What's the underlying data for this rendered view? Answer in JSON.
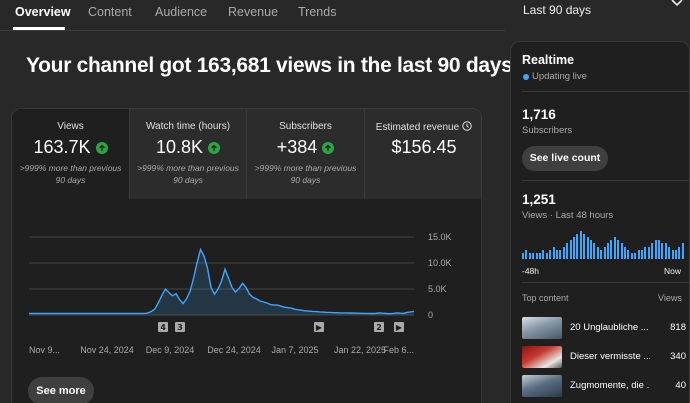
{
  "tabs": [
    {
      "label": "Overview",
      "active": true
    },
    {
      "label": "Content",
      "active": false
    },
    {
      "label": "Audience",
      "active": false
    },
    {
      "label": "Revenue",
      "active": false
    },
    {
      "label": "Trends",
      "active": false
    }
  ],
  "period_selector": {
    "label": "Last 90 days"
  },
  "headline": "Your channel got 163,681 views in the last 90 days",
  "metrics": [
    {
      "label": "Views",
      "value": "163.7K",
      "change": ">999% more than previous 90 days",
      "trend": "up"
    },
    {
      "label": "Watch time (hours)",
      "value": "10.8K",
      "change": ">999% more than previous 90 days",
      "trend": "up"
    },
    {
      "label": "Subscribers",
      "value": "+384",
      "change": ">999% more than previous 90 days",
      "trend": "up"
    },
    {
      "label": "Estimated revenue",
      "value": "$156.45",
      "icon": "info-icon"
    }
  ],
  "chart_data": {
    "type": "area",
    "series": [
      {
        "name": "",
        "color": "#3ea6ff",
        "values": [
          300,
          300,
          300,
          300,
          300,
          300,
          300,
          300,
          300,
          300,
          300,
          300,
          300,
          300,
          300,
          300,
          300,
          300,
          300,
          300,
          300,
          300,
          300,
          300,
          300,
          300,
          300,
          300,
          300,
          300,
          300,
          300,
          300,
          300,
          400,
          700,
          1200,
          2400,
          3800,
          5000,
          4300,
          3700,
          4100,
          3000,
          2200,
          3100,
          4500,
          7000,
          10000,
          12600,
          11300,
          9000,
          5300,
          4000,
          5000,
          6500,
          8800,
          7100,
          5300,
          4400,
          5100,
          6100,
          5300,
          4000,
          3400,
          3100,
          2700,
          2500,
          2300,
          2000,
          1900,
          1900,
          1700,
          1500,
          1400,
          1300,
          1100,
          1000,
          900,
          800,
          750,
          700,
          650,
          600,
          550,
          500,
          500,
          450,
          450,
          400,
          400,
          400,
          380,
          350,
          350,
          330,
          300,
          300,
          280,
          300,
          400,
          350,
          300,
          250,
          300,
          400,
          350,
          300,
          500,
          600,
          700
        ]
      }
    ],
    "y_ticks": [
      "15.0K",
      "10.0K",
      "5.0K",
      "0"
    ],
    "ylim": [
      0,
      15000
    ],
    "x_ticks": [
      "Nov 9...",
      "Nov 24, 2024",
      "Dec 9, 2024",
      "Dec 24, 2024",
      "Jan 7, 2025",
      "Jan 22, 2025",
      "Feb 6..."
    ],
    "grid": true,
    "markers": [
      {
        "label": "4"
      },
      {
        "label": "3"
      },
      {
        "label": "▶"
      },
      {
        "label": "2"
      },
      {
        "label": "▶"
      }
    ]
  },
  "see_more_label": "See more",
  "realtime": {
    "title": "Realtime",
    "live_label": "Updating live",
    "subscribers_value": "1,716",
    "subscribers_label": "Subscribers",
    "live_count_button": "See live count",
    "views_value": "1,251",
    "views_label": "Views · Last 48 hours",
    "bar_values": [
      2,
      3,
      2,
      2,
      2,
      2,
      3,
      2,
      3,
      4,
      3,
      3,
      4,
      5,
      6,
      7,
      8,
      9,
      8,
      7,
      6,
      5,
      4,
      3,
      4,
      5,
      6,
      7,
      6,
      5,
      4,
      3,
      2,
      2,
      3,
      3,
      4,
      4,
      5,
      6,
      6,
      5,
      5,
      4,
      3,
      3,
      4,
      5,
      6,
      7,
      8,
      9,
      10,
      9,
      8,
      7,
      6,
      5,
      4,
      4,
      5,
      6,
      8,
      9,
      10,
      11,
      12,
      13,
      12,
      11,
      10,
      9,
      8,
      7,
      6,
      5,
      5,
      6,
      7,
      7,
      8,
      8,
      9,
      10,
      11,
      12,
      13,
      14,
      13,
      12,
      11,
      10,
      12,
      13,
      14,
      15,
      16,
      17,
      18,
      19,
      18,
      17,
      16,
      15,
      14,
      13,
      12,
      13,
      14,
      16,
      18,
      20,
      22,
      24,
      23,
      21,
      19,
      17,
      16,
      15,
      14,
      13,
      12,
      12,
      13,
      14,
      15,
      16,
      17,
      16,
      15,
      14,
      13,
      12,
      11,
      10,
      9,
      8,
      7,
      6,
      6,
      5,
      5,
      4,
      4,
      3,
      3,
      3,
      3,
      3,
      4,
      4,
      5,
      5,
      6,
      6,
      7,
      8,
      9,
      10,
      11,
      12,
      13,
      14,
      13,
      12,
      11,
      10,
      9,
      8,
      7,
      6,
      5,
      4,
      4,
      3,
      3,
      3,
      2,
      2,
      2,
      3,
      3,
      4,
      5,
      6,
      7,
      8,
      9,
      10,
      11,
      12,
      13,
      14,
      15,
      16,
      17,
      16,
      15,
      14,
      13,
      12,
      11,
      10,
      9,
      8,
      8,
      7,
      7,
      6,
      6,
      5,
      5,
      4,
      4,
      5,
      6,
      7,
      8,
      9,
      10,
      11,
      12,
      13,
      14,
      15,
      16,
      15,
      14,
      13,
      12,
      11,
      10,
      9,
      8,
      7,
      6,
      5,
      4,
      3,
      3
    ],
    "axis_start": "-48h",
    "axis_end": "Now",
    "top_content_label": "Top content",
    "views_col_label": "Views",
    "top_content": [
      {
        "title": "20 Unglaubliche ...",
        "views": "818"
      },
      {
        "title": "Dieser vermisste ...",
        "views": "340"
      },
      {
        "title": "Zugmomente, die ...",
        "views": "40"
      }
    ]
  },
  "colors": {
    "accent_blue": "#3ea6ff",
    "up_green": "#2ba640",
    "background": "#282828",
    "card": "#1f1f1f"
  }
}
